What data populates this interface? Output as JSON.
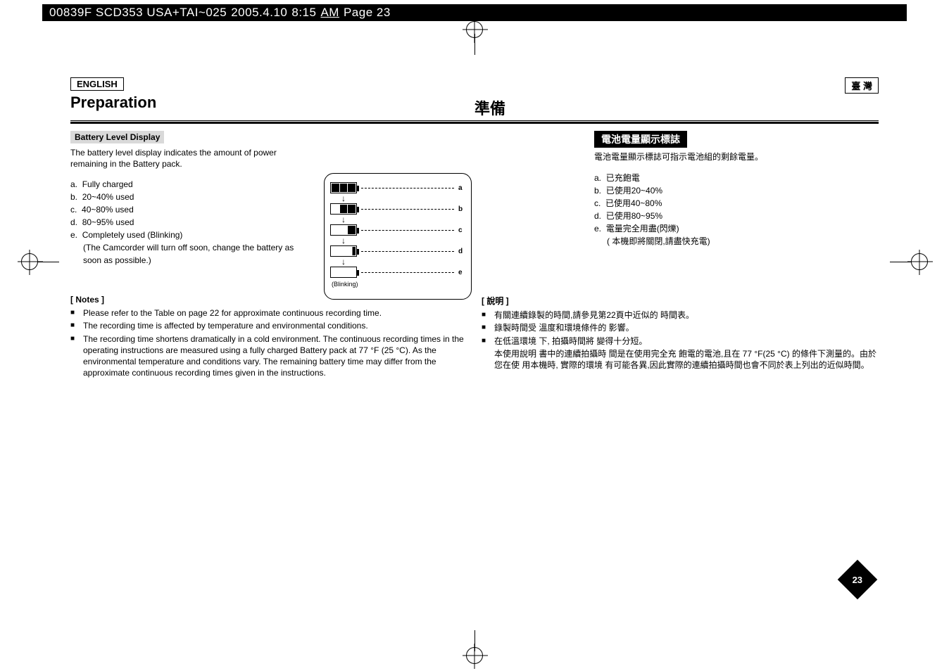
{
  "header": {
    "code": "00839F SCD353 USA+TAI~025",
    "date": "2005.4.10",
    "time": "8:15",
    "ampm": "AM",
    "page_word": "Page 23"
  },
  "left": {
    "lang_box": "ENGLISH",
    "section_title": "Preparation",
    "sub_head": "Battery Level Display",
    "intro": "The battery level display indicates the amount of power remaining in the Battery pack.",
    "levels": {
      "a": "Fully charged",
      "b": "20~40% used",
      "c": "40~80% used",
      "d": "80~95% used",
      "e": "Completely used (Blinking)",
      "e_sub": "(The Camcorder will turn off soon, change the battery as soon as possible.)"
    },
    "notes_head": "[ Notes ]",
    "notes": [
      "Please refer to the Table on page 22 for approximate continuous recording time.",
      "The recording time is affected by temperature and environmental conditions.",
      "The recording time shortens dramatically in a cold environment. The continuous recording times in the operating instructions are measured using a fully charged Battery pack at 77 °F (25 °C). As the environmental temperature and conditions vary. The remaining battery time may differ from the approximate continuous recording times given in the instructions."
    ]
  },
  "right": {
    "lang_box": "臺 灣",
    "section_title": "準備",
    "sub_head": "電池電量顯示標誌",
    "intro": "電池電量顯示標誌可指示電池組的剩餘電量。",
    "levels": {
      "a": "已充飽電",
      "b": "已使用20~40%",
      "c": "已使用40~80%",
      "d": "已使用80~95%",
      "e": "電量完全用盡(閃爍)",
      "e_sub": "( 本機即將關閉,請盡快充電)"
    },
    "notes_head": "[ 說明 ]",
    "notes": [
      "有關連續錄製的時間,請參見第22頁中近似的 時間表。",
      "錄製時間受 溫度和環境條件的 影響。",
      "在低溫環境 下, 拍攝時間將 變得十分短。"
    ],
    "notes_cont": "本使用說明 書中的連續拍攝時 間是在使用完全充 飽電的電池,且在 77 °F(25 °C) 的條件下測量的。由於您在使 用本機時, 實際的環境 有可能各異,因此實際的連續拍攝時間也會不同於表上列出的近似時間。"
  },
  "diagram": {
    "labels": {
      "a": "a",
      "b": "b",
      "c": "c",
      "d": "d",
      "e": "e"
    },
    "blinking": "(Blinking)"
  },
  "page_number": "23"
}
